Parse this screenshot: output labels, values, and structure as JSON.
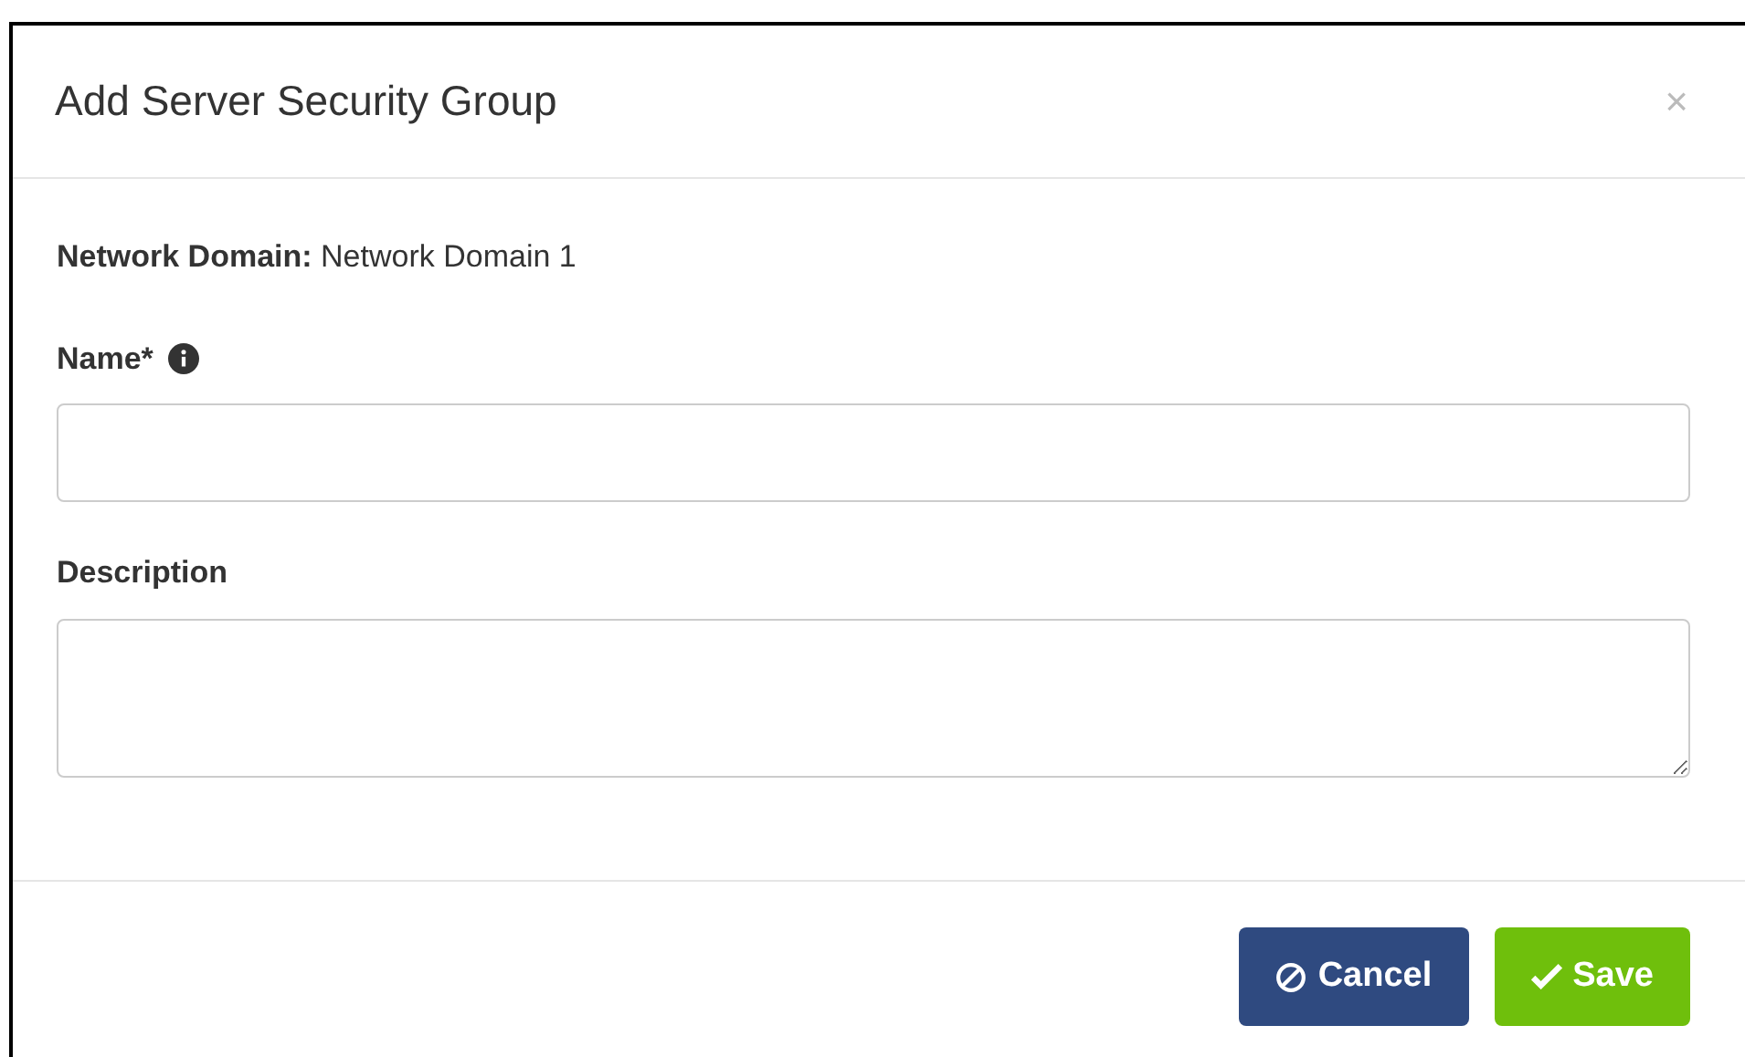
{
  "dialog": {
    "title": "Add Server Security Group",
    "close": "×"
  },
  "domain": {
    "label": "Network Domain:",
    "value": "Network Domain 1"
  },
  "fields": [
    {
      "kind": "input",
      "label": "Name*",
      "info": true
    },
    {
      "kind": "textarea",
      "label": "Description",
      "info": false
    }
  ],
  "buttons": [
    {
      "kind": "cancel",
      "label": "Cancel"
    },
    {
      "kind": "save",
      "label": "Save"
    }
  ]
}
